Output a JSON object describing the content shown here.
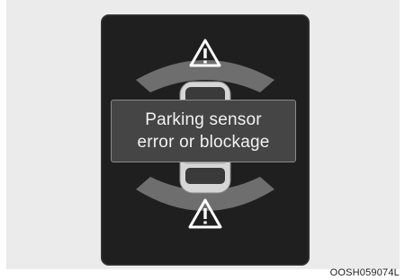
{
  "display": {
    "message_line1": "Parking sensor",
    "message_line2": "error or blockage"
  },
  "image_code": "OOSH059074L",
  "icons": {
    "front_warning": "warning-triangle-icon",
    "rear_warning": "warning-triangle-icon",
    "vehicle": "car-top-view-icon"
  },
  "colors": {
    "panel_background": "#1f1f1f",
    "sensor_zone": "#6e6e6e",
    "message_box": "#454545",
    "text": "#f2f2f2"
  }
}
